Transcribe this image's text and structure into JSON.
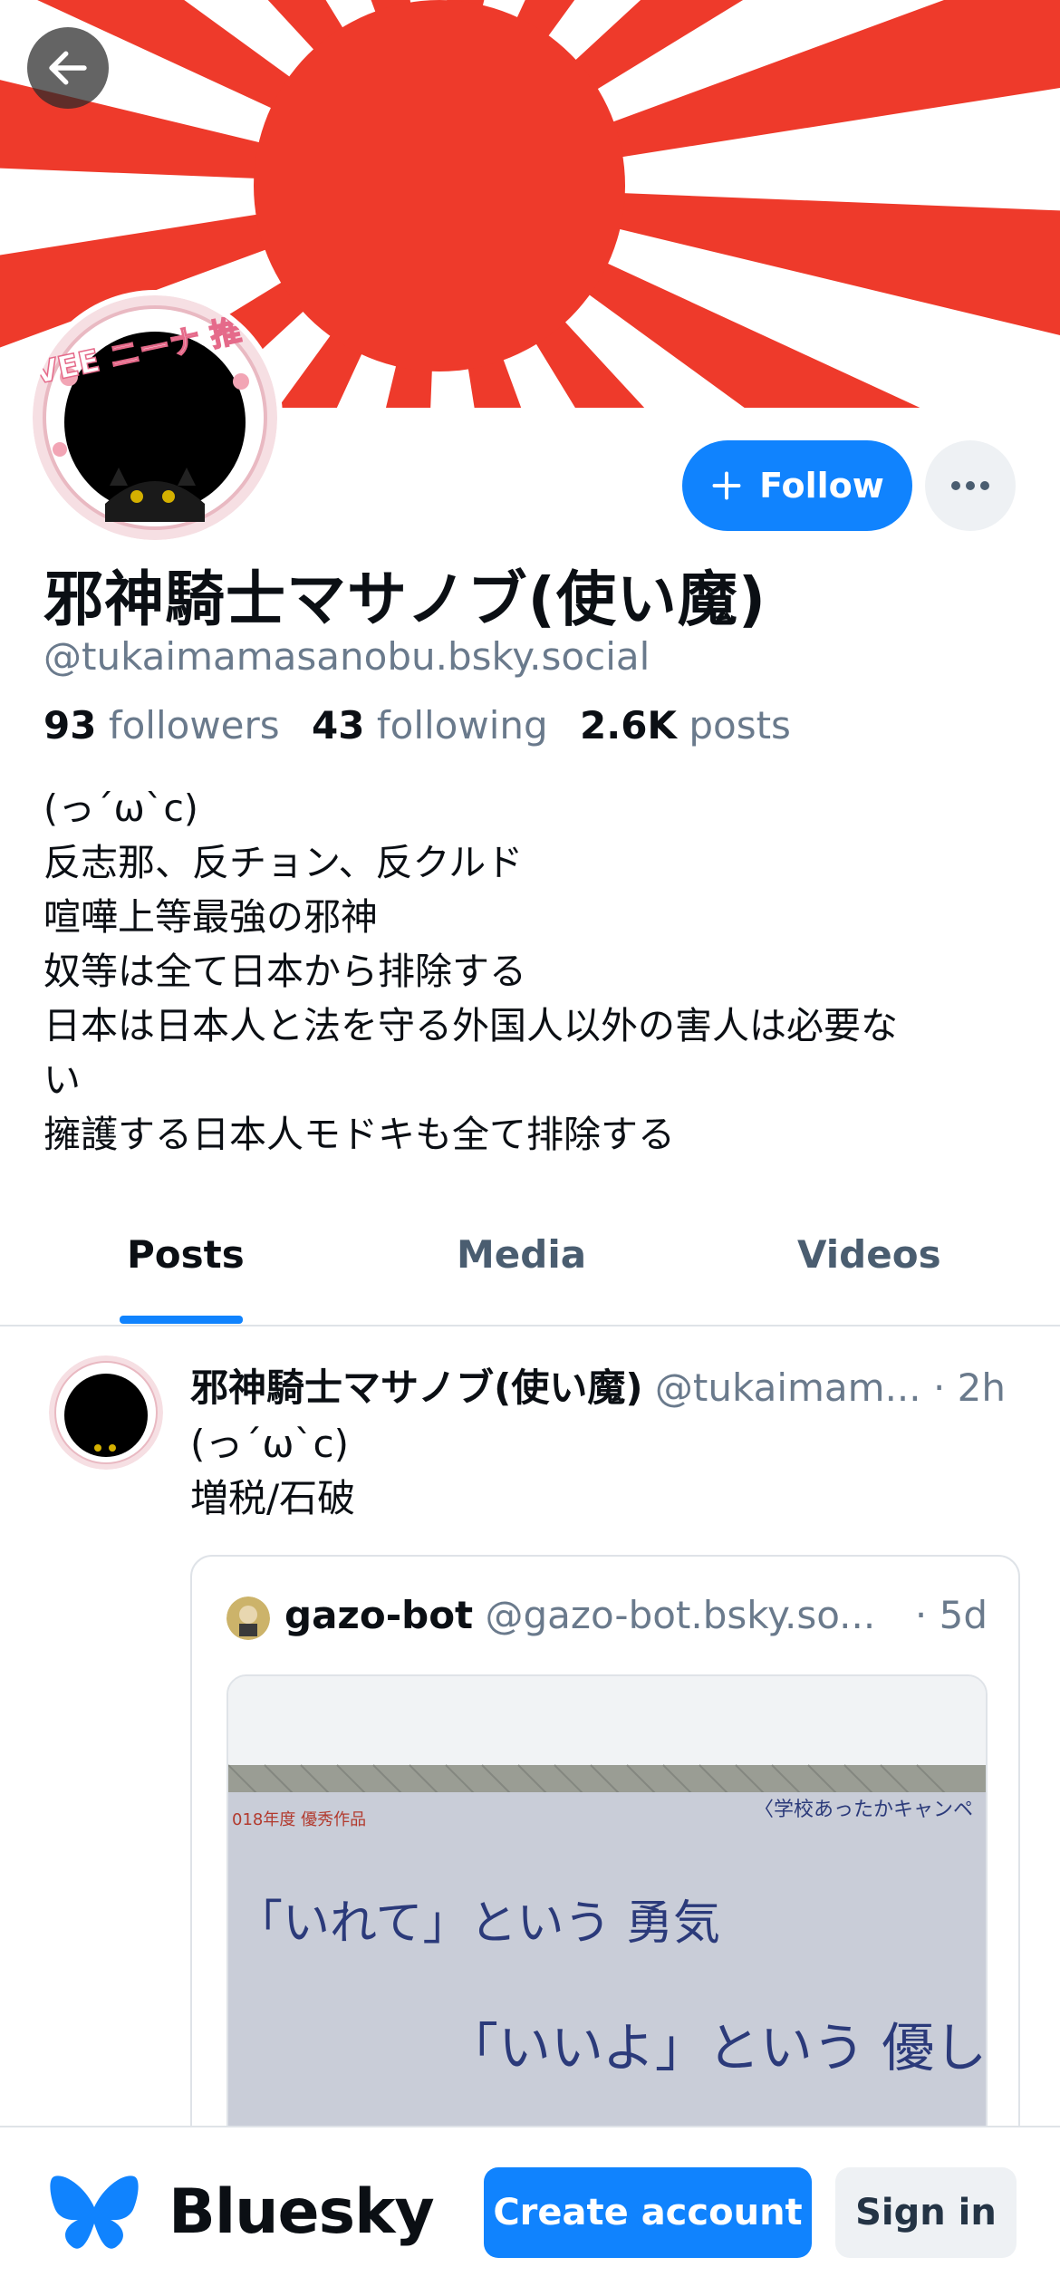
{
  "colors": {
    "accent": "#1083fe",
    "banner_red": "#ee3a2b",
    "muted": "#6a7a8c"
  },
  "header": {
    "back_icon": "arrow-left-icon"
  },
  "profile": {
    "display_name": "邪神騎士マサノブ(使い魔)",
    "handle": "@tukaimamasanobu.bsky.social",
    "followers_count": "93",
    "followers_label": "followers",
    "following_count": "43",
    "following_label": "following",
    "posts_count": "2.6K",
    "posts_label": "posts",
    "bio_lines": [
      "(っ´ω`c)",
      "反志那、反チョン、反クルド",
      "喧嘩上等最強の邪神",
      "奴等は全て日本から排除する",
      "日本は日本人と法を守る外国人以外の害人は必要な",
      "い",
      "擁護する日本人モドキも全て排除する"
    ],
    "avatar_text": "VEE ニーナ 推し"
  },
  "actions": {
    "follow_label": "Follow",
    "more_icon": "ellipsis-icon"
  },
  "tabs": [
    {
      "label": "Posts",
      "active": true
    },
    {
      "label": "Media",
      "active": false
    },
    {
      "label": "Videos",
      "active": false
    }
  ],
  "post": {
    "author_name": "邪神騎士マサノブ(使い魔)",
    "author_handle": "@tukaimam...",
    "time": "· 2h",
    "text_lines": [
      "(っ´ω`c)",
      "増税/石破"
    ],
    "quote": {
      "author_name": "gazo-bot",
      "author_handle": "@gazo-bot.bsky.so...",
      "time": "· 5d",
      "image_texts": {
        "top_left": "018年度 優秀作品",
        "top_right": "〈学校あったかキャンペ",
        "line1": "「いれて」という 勇気",
        "line2": "「いいよ」という 優しさ"
      }
    }
  },
  "bottom_bar": {
    "brand_name": "Bluesky",
    "create_label": "Create account",
    "signin_label": "Sign in"
  }
}
